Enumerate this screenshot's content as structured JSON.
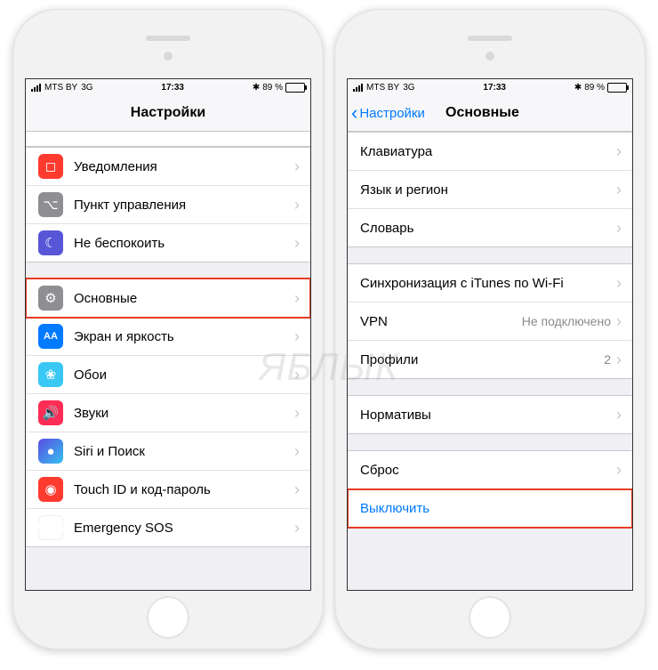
{
  "status": {
    "carrier": "MTS BY",
    "network": "3G",
    "time": "17:33",
    "bluetooth": "✱",
    "battery_pct": "89 %"
  },
  "left": {
    "title": "Настройки",
    "group1": [
      {
        "label": "Уведомления"
      },
      {
        "label": "Пункт управления"
      },
      {
        "label": "Не беспокоить"
      }
    ],
    "group2": [
      {
        "label": "Основные",
        "highlight": true
      },
      {
        "label": "Экран и яркость"
      },
      {
        "label": "Обои"
      },
      {
        "label": "Звуки"
      },
      {
        "label": "Siri и Поиск"
      },
      {
        "label": "Touch ID и код-пароль"
      },
      {
        "label": "Emergency SOS"
      }
    ]
  },
  "right": {
    "back": "Настройки",
    "title": "Основные",
    "group1": [
      {
        "label": "Клавиатура"
      },
      {
        "label": "Язык и регион"
      },
      {
        "label": "Словарь"
      }
    ],
    "group2": [
      {
        "label": "Синхронизация с iTunes по Wi-Fi"
      },
      {
        "label": "VPN",
        "value": "Не подключено"
      },
      {
        "label": "Профили",
        "value": "2"
      }
    ],
    "group3": [
      {
        "label": "Нормативы"
      }
    ],
    "group4": [
      {
        "label": "Сброс"
      },
      {
        "label": "Выключить",
        "link": true,
        "highlight": true
      }
    ]
  },
  "watermark": "ЯБЛЫК"
}
